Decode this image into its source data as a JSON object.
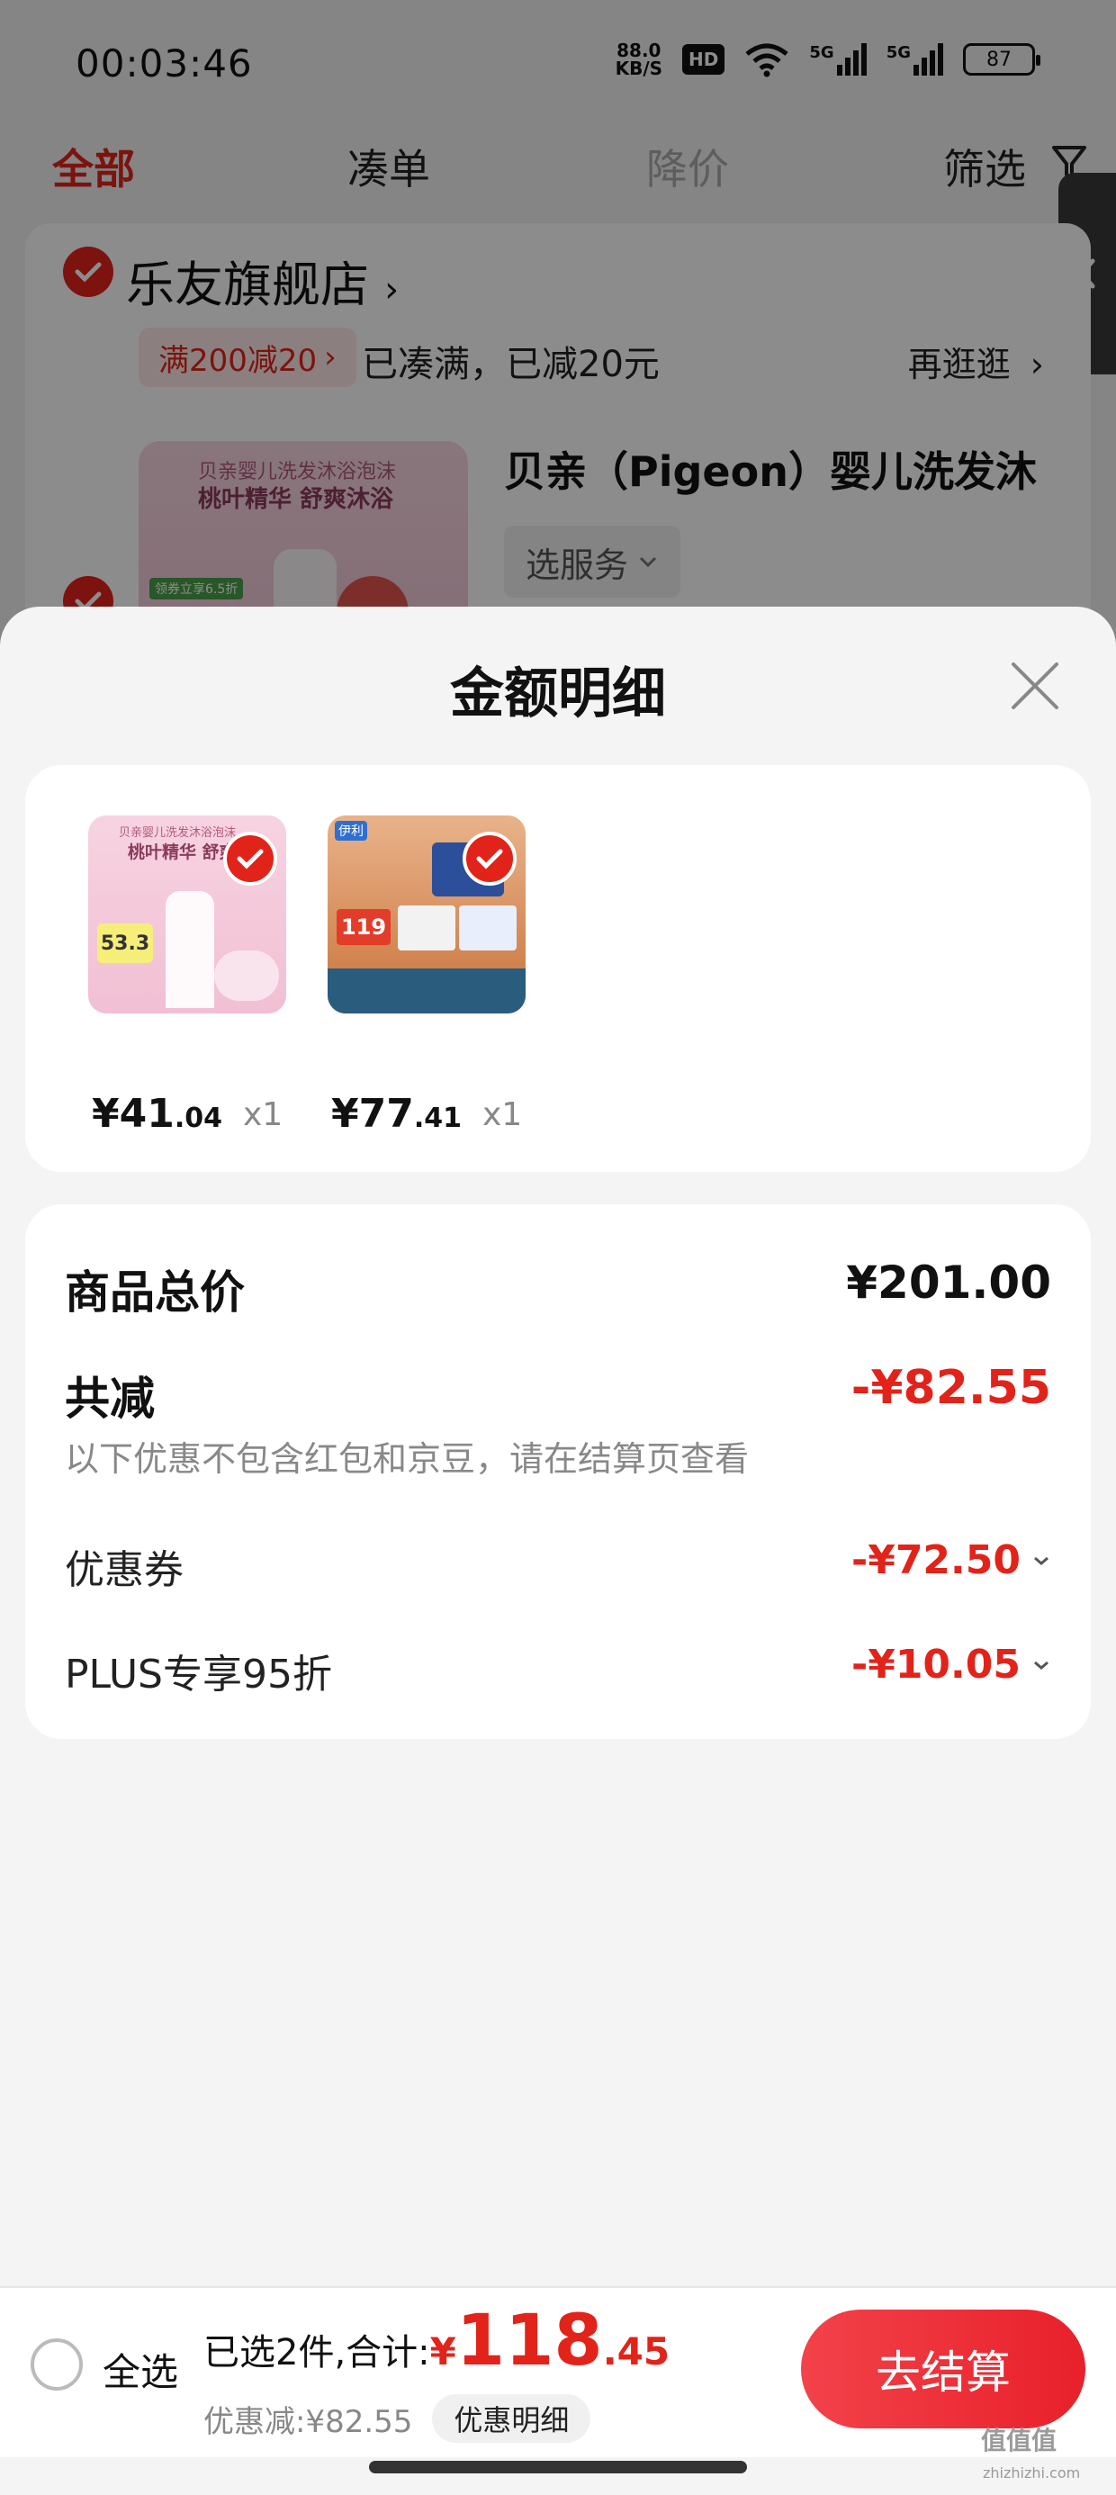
{
  "status_bar": {
    "time": "00:03:46",
    "net_speed_value": "88.0",
    "net_speed_unit": "KB/S",
    "hd_badge": "HD",
    "signal_1": "5G",
    "signal_2": "5G",
    "battery": "87"
  },
  "tabs": [
    {
      "label": "全部",
      "active": true
    },
    {
      "label": "凑单",
      "active": false
    },
    {
      "label": "降价",
      "active": false
    },
    {
      "label": "筛选",
      "active": false
    }
  ],
  "shop": {
    "name": "乐友旗舰店",
    "promo_tag": "满200减20",
    "promo_text": "已凑满，已减20元",
    "browse_more": "再逛逛",
    "product_title": "贝亲（Pigeon）婴儿洗发沐",
    "service_select": "选服务",
    "thumb_line_1": "贝亲婴儿洗发沐浴泡沫",
    "thumb_line_2": "桃叶精华 舒爽沐浴",
    "thumb_tag": "领券立享6.5折"
  },
  "sheet": {
    "title": "金额明细",
    "items": [
      {
        "price_int": "¥41",
        "price_dec": ".04",
        "qty": "x1",
        "thumb_line_1": "贝亲婴儿洗发沐浴泡沫",
        "thumb_line_2": "桃叶精华 舒爽",
        "thumb_badge": "53.3",
        "thumb_colors": [
          "#f7d3e1",
          "#f1bfd3"
        ]
      },
      {
        "price_int": "¥77",
        "price_dec": ".41",
        "qty": "x1",
        "thumb_line_1": "伊利",
        "thumb_line_2": "119",
        "thumb_colors": [
          "#e9b38a",
          "#c9733a"
        ]
      }
    ],
    "summary": {
      "total_label": "商品总价",
      "total_value": "¥201.00",
      "discount_label": "共减",
      "discount_value": "-¥82.55",
      "note": "以下优惠不包含红包和京豆，请在结算页查看",
      "rows": [
        {
          "label": "优惠券",
          "value": "-¥72.50"
        },
        {
          "label": "PLUS专享95折",
          "value": "-¥10.05"
        }
      ]
    }
  },
  "checkout": {
    "select_all": "全选",
    "selected_text": "已选2件,合计:",
    "total_yen": "¥",
    "total_int": "118",
    "total_dec": ".45",
    "discount_text": "优惠减:¥82.55",
    "detail_chip": "优惠明细",
    "button": "去结算"
  },
  "watermark": {
    "text": "值值值",
    "sub": "zhizhizhi.com"
  },
  "colors": {
    "accent_red": "#e2231a",
    "overlay": "rgba(0,0,0,0.45)"
  }
}
